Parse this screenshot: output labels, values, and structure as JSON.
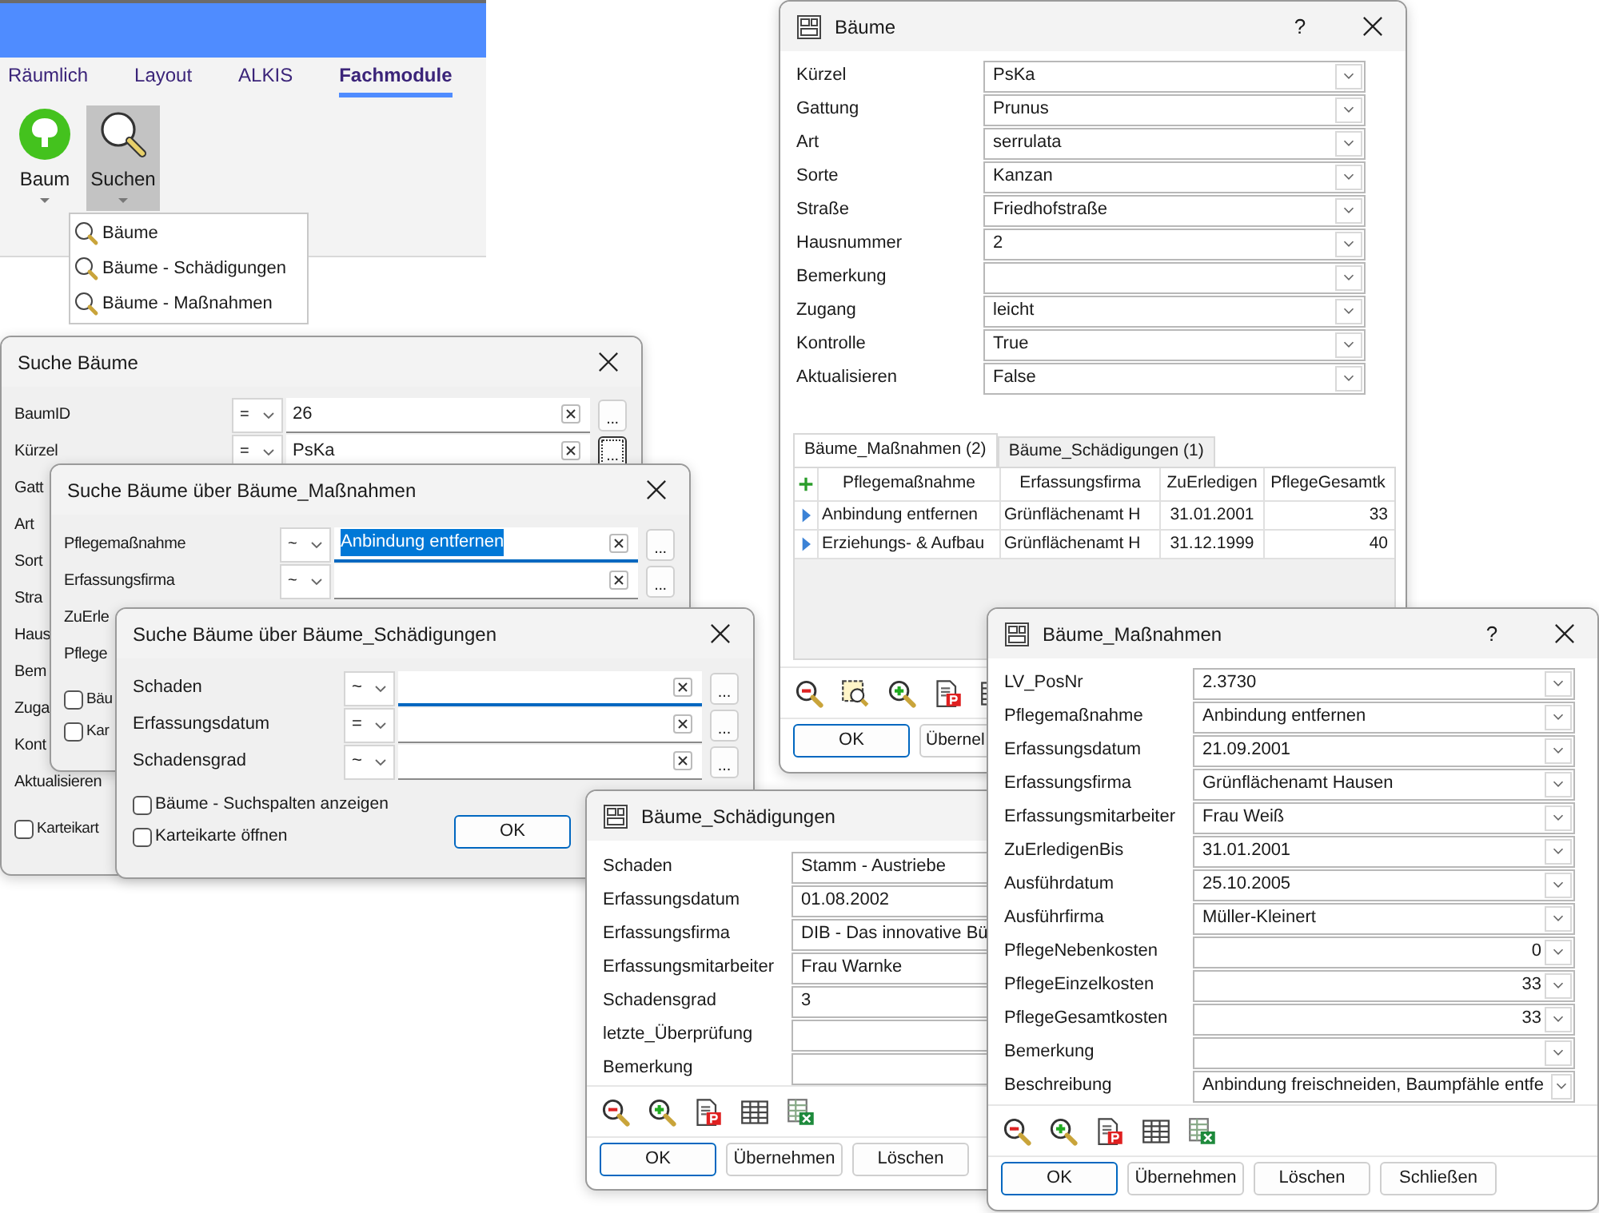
{
  "ribbon": {
    "tabs": [
      {
        "label": "Räumlich",
        "selected": false
      },
      {
        "label": "Layout",
        "selected": false
      },
      {
        "label": "ALKIS",
        "selected": false
      },
      {
        "label": "Fachmodule",
        "selected": true
      }
    ],
    "buttons": [
      {
        "label": "Baum",
        "kind": "tree",
        "selected": false
      },
      {
        "label": "Suchen",
        "kind": "search",
        "selected": true
      }
    ],
    "menu": [
      "Bäume",
      "Bäume - Schädigungen",
      "Bäume - Maßnahmen"
    ]
  },
  "windows": [
    {
      "title": "Suche Bäume",
      "kind": "search",
      "close": true,
      "rows": [
        {
          "label": "BaumID",
          "kind": "search",
          "operator": "=",
          "value": "26",
          "button": "...",
          "focused": false,
          "highlighted": false,
          "button_focused": false
        },
        {
          "label": "Kürzel",
          "kind": "search",
          "operator": "=",
          "value": "PsKa",
          "button": "...",
          "focused": false,
          "highlighted": false,
          "button_focused": true
        },
        {
          "label": "Gatt",
          "kind": "label"
        },
        {
          "label": "Art",
          "kind": "label"
        },
        {
          "label": "Sort",
          "kind": "label"
        },
        {
          "label": "Stra",
          "kind": "label"
        },
        {
          "label": "Haus",
          "kind": "label"
        },
        {
          "label": "Bem",
          "kind": "label"
        },
        {
          "label": "Zuga",
          "kind": "label"
        },
        {
          "label": "Kont",
          "kind": "label"
        },
        {
          "label": "Aktualisieren",
          "kind": "label"
        }
      ],
      "checkboxes": [
        {
          "label": "Karteikart",
          "checked": false
        }
      ]
    },
    {
      "title": "Suche Bäume über Bäume_Maßnahmen",
      "kind": "search",
      "close": true,
      "rows": [
        {
          "label": "Pflegemaßnahme",
          "kind": "search",
          "operator": "~",
          "value": "Anbindung entfernen",
          "button": "...",
          "focused": true,
          "highlighted": true,
          "button_focused": false
        },
        {
          "label": "Erfassungsfirma",
          "kind": "search",
          "operator": "~",
          "button": "...",
          "focused": false,
          "button_focused": false
        },
        {
          "label": "ZuErle",
          "kind": "label"
        },
        {
          "label": "Pflege",
          "kind": "label"
        }
      ],
      "checkboxes": [
        {
          "label": "Bäu",
          "checked": false
        },
        {
          "label": "Kar",
          "checked": false
        }
      ]
    },
    {
      "title": "Suche Bäume über Bäume_Schädigungen",
      "kind": "search",
      "close": true,
      "rows": [
        {
          "label": "Schaden",
          "kind": "search",
          "operator": "~",
          "button": "...",
          "focused": true,
          "button_focused": false
        },
        {
          "label": "Erfassungsdatum",
          "kind": "search",
          "operator": "=",
          "button": "...",
          "focused": false,
          "button_focused": false
        },
        {
          "label": "Schadensgrad",
          "kind": "search",
          "operator": "~",
          "button": "...",
          "focused": false,
          "button_focused": false
        }
      ],
      "checkboxes": [
        {
          "label": "Bäume - Suchspalten anzeigen",
          "checked": false
        },
        {
          "label": "Karteikarte öffnen",
          "checked": false
        }
      ],
      "buttons": [
        {
          "label": "OK",
          "default": true
        }
      ]
    },
    {
      "title": "Bäume",
      "kind": "form",
      "help": "?",
      "close": true,
      "rows": [
        {
          "label": "Kürzel",
          "kind": "combo",
          "value": "PsKa"
        },
        {
          "label": "Gattung",
          "kind": "combo",
          "value": "Prunus"
        },
        {
          "label": "Art",
          "kind": "combo",
          "value": "serrulata"
        },
        {
          "label": "Sorte",
          "kind": "combo",
          "value": "Kanzan"
        },
        {
          "label": "Straße",
          "kind": "combo",
          "value": "Friedhofstraße"
        },
        {
          "label": "Hausnummer",
          "kind": "combo",
          "value": "2"
        },
        {
          "label": "Bemerkung",
          "kind": "combo"
        },
        {
          "label": "Zugang",
          "kind": "combo",
          "value": "leicht"
        },
        {
          "label": "Kontrolle",
          "kind": "combo",
          "value": "True"
        },
        {
          "label": "Aktualisieren",
          "kind": "combo",
          "value": "False"
        }
      ],
      "table": {
        "tabs": [
          {
            "label": "Bäume_Maßnahmen (2)",
            "selected": true
          },
          {
            "label": "Bäume_Schädigungen (1)",
            "selected": false
          }
        ],
        "columns": [
          "Pflegemaßnahme",
          "Erfassungsfirma",
          "ZuErledigen",
          "PflegeGesamtk"
        ],
        "rows": [
          [
            "Anbindung entfernen",
            "Grünflächenamt H",
            "31.01.2001",
            "33"
          ],
          [
            "Erziehungs- & Aufbau",
            "Grünflächenamt H",
            "31.12.1999",
            "40"
          ]
        ]
      },
      "buttons": [
        {
          "label": "OK",
          "default": true
        },
        {
          "label": "Übernel",
          "default": false
        }
      ]
    },
    {
      "title": "Bäume_Schädigungen",
      "kind": "form",
      "rows": [
        {
          "label": "Schaden",
          "kind": "text",
          "value": "Stamm - Austriebe"
        },
        {
          "label": "Erfassungsdatum",
          "kind": "text",
          "value": "01.08.2002"
        },
        {
          "label": "Erfassungsfirma",
          "kind": "text",
          "value": "DIB - Das innovative Bü"
        },
        {
          "label": "Erfassungsmitarbeiter",
          "kind": "text",
          "value": "Frau Warnke"
        },
        {
          "label": "Schadensgrad",
          "kind": "text",
          "value": "3"
        },
        {
          "label": "letzte_Überprüfung",
          "kind": "text"
        },
        {
          "label": "Bemerkung",
          "kind": "text"
        }
      ],
      "buttons": [
        {
          "label": "OK",
          "default": true
        },
        {
          "label": "Übernehmen",
          "default": false
        },
        {
          "label": "Löschen",
          "default": false
        }
      ]
    },
    {
      "title": "Bäume_Maßnahmen",
      "kind": "form",
      "help": "?",
      "close": true,
      "rows": [
        {
          "label": "LV_PosNr",
          "kind": "combo",
          "value": "2.3730"
        },
        {
          "label": "Pflegemaßnahme",
          "kind": "combo",
          "value": "Anbindung entfernen"
        },
        {
          "label": "Erfassungsdatum",
          "kind": "combo",
          "value": "21.09.2001"
        },
        {
          "label": "Erfassungsfirma",
          "kind": "combo",
          "value": "Grünflächenamt Hausen"
        },
        {
          "label": "Erfassungsmitarbeiter",
          "kind": "combo",
          "value": "Frau Weiß"
        },
        {
          "label": "ZuErledigenBis",
          "kind": "combo",
          "value": "31.01.2001"
        },
        {
          "label": "Ausführdatum",
          "kind": "combo",
          "value": "25.10.2005"
        },
        {
          "label": "Ausführfirma",
          "kind": "combo",
          "value": "Müller-Kleinert"
        },
        {
          "label": "PflegeNebenkosten",
          "kind": "number",
          "value": "0"
        },
        {
          "label": "PflegeEinzelkosten",
          "kind": "number",
          "value": "33"
        },
        {
          "label": "PflegeGesamtkosten",
          "kind": "number",
          "value": "33"
        },
        {
          "label": "Bemerkung",
          "kind": "combo"
        },
        {
          "label": "Beschreibung",
          "kind": "combo",
          "value": "Anbindung freischneiden, Baumpfähle entfe"
        }
      ],
      "buttons": [
        {
          "label": "OK",
          "default": true
        },
        {
          "label": "Übernehmen",
          "default": false
        },
        {
          "label": "Löschen",
          "default": false
        },
        {
          "label": "Schließen",
          "default": false
        }
      ]
    }
  ]
}
